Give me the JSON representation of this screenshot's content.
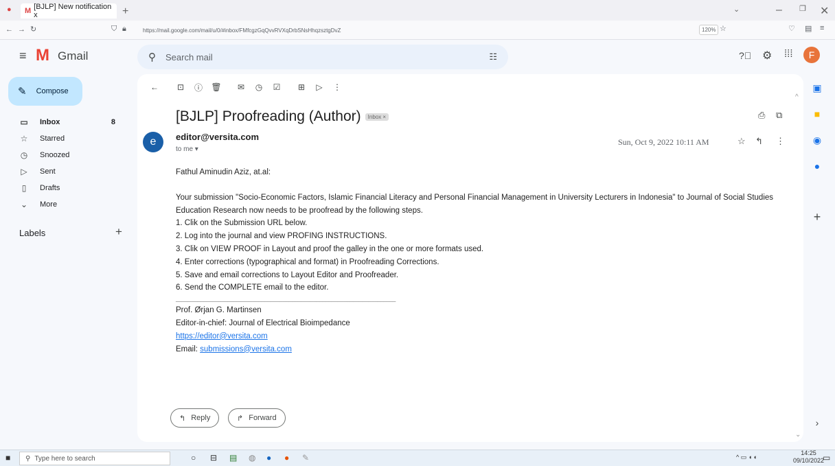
{
  "browser": {
    "tab_title": "[BJLP] New notification x",
    "new_tab": "+",
    "url": "https://mail.google.com/mail/u/0/#inbox/FMfcgzGqQvvRVXqDrbSNsHhqzsztgDvZ",
    "zoom": "120%"
  },
  "gmail": {
    "brand": "Gmail",
    "search_placeholder": "Search mail",
    "account_initial": "F",
    "compose_label": "Compose",
    "nav": [
      {
        "label": "Inbox",
        "count": "8",
        "icon": "inbox-icon"
      },
      {
        "label": "Starred",
        "count": "",
        "icon": "star-icon"
      },
      {
        "label": "Snoozed",
        "count": "",
        "icon": "clock-icon"
      },
      {
        "label": "Sent",
        "count": "",
        "icon": "send-icon"
      },
      {
        "label": "Drafts",
        "count": "",
        "icon": "draft-icon"
      },
      {
        "label": "More",
        "count": "",
        "icon": "chevron-down-icon"
      }
    ],
    "labels_heading": "Labels",
    "labels_add": "+"
  },
  "email": {
    "subject": "[BJLP] Proofreading (Author)",
    "inbox_chip": "Inbox ×",
    "avatar_initial": "e",
    "sender": "editor@versita.com",
    "to": "to me ▾",
    "date": "Sun, Oct 9, 2022   10:11 AM",
    "greeting": "Fathul Aminudin Aziz, at.al:",
    "intro": "Your submission \"Socio-Economic Factors, Islamic Financial Literacy and Personal Financial Management in University Lecturers in Indonesia\" to Journal of Social Studies Education Research now needs to be proofread by the following steps.",
    "steps": [
      "1. Clik on the Submission URL below.",
      "2. Log into the journal and view PROFING INSTRUCTIONS.",
      "3. Clik on VIEW PROOF in Layout and proof the galley in the one or more formats used.",
      "4. Enter corrections (typographical and format) in Proofreading Corrections.",
      "5. Save and email corrections to Layout Editor and Proofreader.",
      "6. Send the COMPLETE email to the editor."
    ],
    "divider": "________________________________________________________________________",
    "signature_name": "Prof. Ørjan G. Martinsen",
    "signature_title": "Editor-in-chief: Journal of Electrical Bioimpedance",
    "signature_link": "https://editor@versita.com",
    "email_label": "Email: ",
    "email_link": "submissions@versita.com",
    "reply_label": "Reply",
    "forward_label": "Forward"
  },
  "taskbar": {
    "search_placeholder": "Type here to search",
    "time": "14:25",
    "date": "09/10/2022"
  }
}
